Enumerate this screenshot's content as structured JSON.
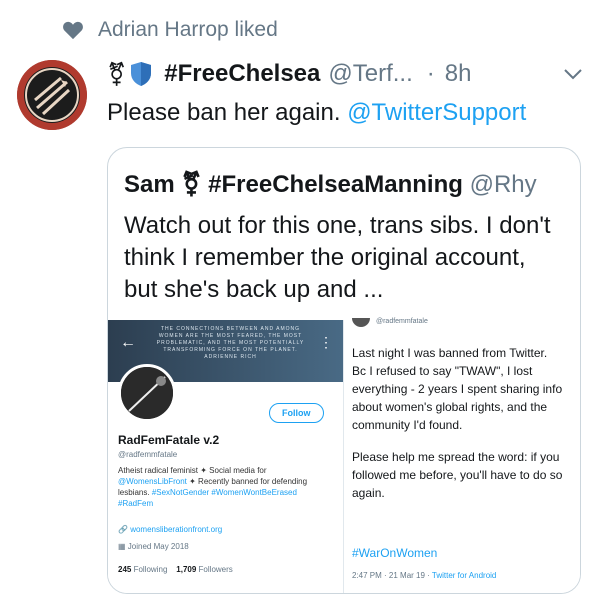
{
  "social_context": {
    "icon": "heart-icon",
    "text": "Adrian Harrop liked"
  },
  "tweet": {
    "symbol": "⚧",
    "name": "#FreeChelsea",
    "handle": "@Terf...",
    "dot": "·",
    "time": "8h",
    "text": "Please ban her again.",
    "mention": "@TwitterSupport"
  },
  "quoted": {
    "name": "Sam",
    "symbol": "⚧",
    "name_tag": "#FreeChelseaManning",
    "handle": "@Rhy",
    "text": "Watch out for this one, trans sibs. I don't think I remember the original account, but she's back up and ..."
  },
  "screenshot": {
    "profile": {
      "banner_text": "THE CONNECTIONS BETWEEN AND AMONG WOMEN ARE THE MOST FEARED, THE MOST PROBLEMATIC, AND THE MOST POTENTIALLY TRANSFORMING FORCE ON THE PLANET.",
      "banner_author": "ADRIENNE RICH",
      "follow_label": "Follow",
      "name": "RadFemFatale v.2",
      "handle": "@radfemmfatale",
      "bio_a": "Atheist radical feminist ✦ Social media for",
      "bio_b_link": "@WomensLibFront",
      "bio_b": "✦ Recently banned for defending lesbians.",
      "bio_c_link": "#SexNotGender #WomenWontBeErased #RadFem",
      "link": "womensliberationfront.org",
      "joined": "Joined May 2018",
      "following_count": "245",
      "following_label": "Following",
      "followers_count": "1,709",
      "followers_label": "Followers"
    },
    "post": {
      "handle": "@radfemmfatale",
      "text1": "Last night I was banned from Twitter. Bc I refused to say \"TWAW\", I lost everything - 2 years I spent sharing info about women's global rights, and the community I'd found.",
      "text2": "Please help me spread the word: if you followed me before, you'll have to do so again.",
      "hashtag": "#WarOnWomen",
      "time": "2:47 PM · 21 Mar 19 ·",
      "client": "Twitter for Android"
    }
  }
}
